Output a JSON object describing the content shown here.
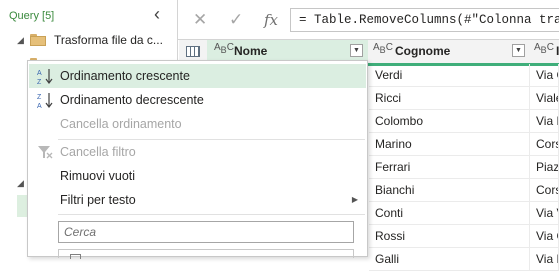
{
  "query_pane": {
    "header": "Query [5]",
    "tree": [
      {
        "label": "Trasforma file da c..."
      }
    ]
  },
  "formula_bar": {
    "cancel_glyph": "✕",
    "confirm_glyph": "✓",
    "fx_label": "fx",
    "formula": "= Table.RemoveColumns(#\"Colonna trasfor"
  },
  "grid": {
    "columns": [
      {
        "type": "ABC",
        "name": "Nome"
      },
      {
        "type": "ABC",
        "name": "Cognome"
      },
      {
        "type": "ABC",
        "name": "In"
      }
    ],
    "cognome": [
      "Verdi",
      "Ricci",
      "Colombo",
      "Marino",
      "Ferrari",
      "Bianchi",
      "Conti",
      "Rossi",
      "Galli"
    ],
    "indirizzo": [
      "Via G",
      "Viale",
      "Via D",
      "Corso",
      "Piazz",
      "Corso",
      "Via V",
      "Via G",
      "Via M"
    ]
  },
  "menu": {
    "sort_asc": "Ordinamento crescente",
    "sort_desc": "Ordinamento decrescente",
    "clear_sort": "Cancella ordinamento",
    "clear_filter": "Cancella filtro",
    "remove_empty": "Rimuovi vuoti",
    "text_filters": "Filtri per testo",
    "search_placeholder": "Cerca"
  },
  "colors": {
    "accent_green": "#3fae7a",
    "highlight": "#dbeee1",
    "disabled_text": "#a6a6a6"
  }
}
